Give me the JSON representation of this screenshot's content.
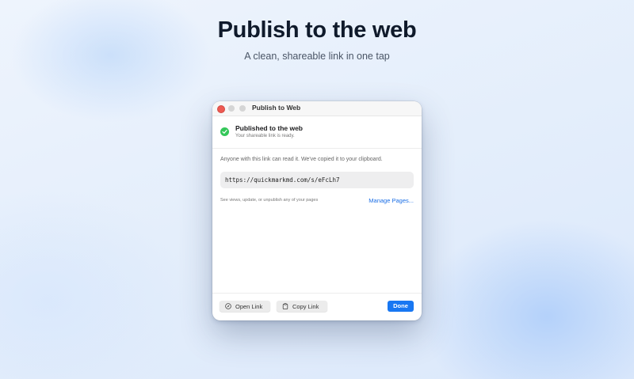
{
  "hero": {
    "title": "Publish to the web",
    "subtitle": "A clean, shareable link in one tap"
  },
  "window": {
    "title": "Publish to Web",
    "status": {
      "title": "Published to the web",
      "subtitle": "Your shareable link is ready.",
      "icon": "check-circle-icon",
      "color": "#34c759"
    },
    "info": "Anyone with this link can read it. We've copied it to your clipboard.",
    "link": "https://quickmarkmd.com/s/eFcLh7",
    "hint": "See views, update, or unpublish any of your pages",
    "manage_label": "Manage Pages...",
    "buttons": {
      "open": "Open Link",
      "copy": "Copy Link",
      "done": "Done"
    },
    "colors": {
      "accent": "#1877f2",
      "close": "#ee5a52"
    }
  }
}
